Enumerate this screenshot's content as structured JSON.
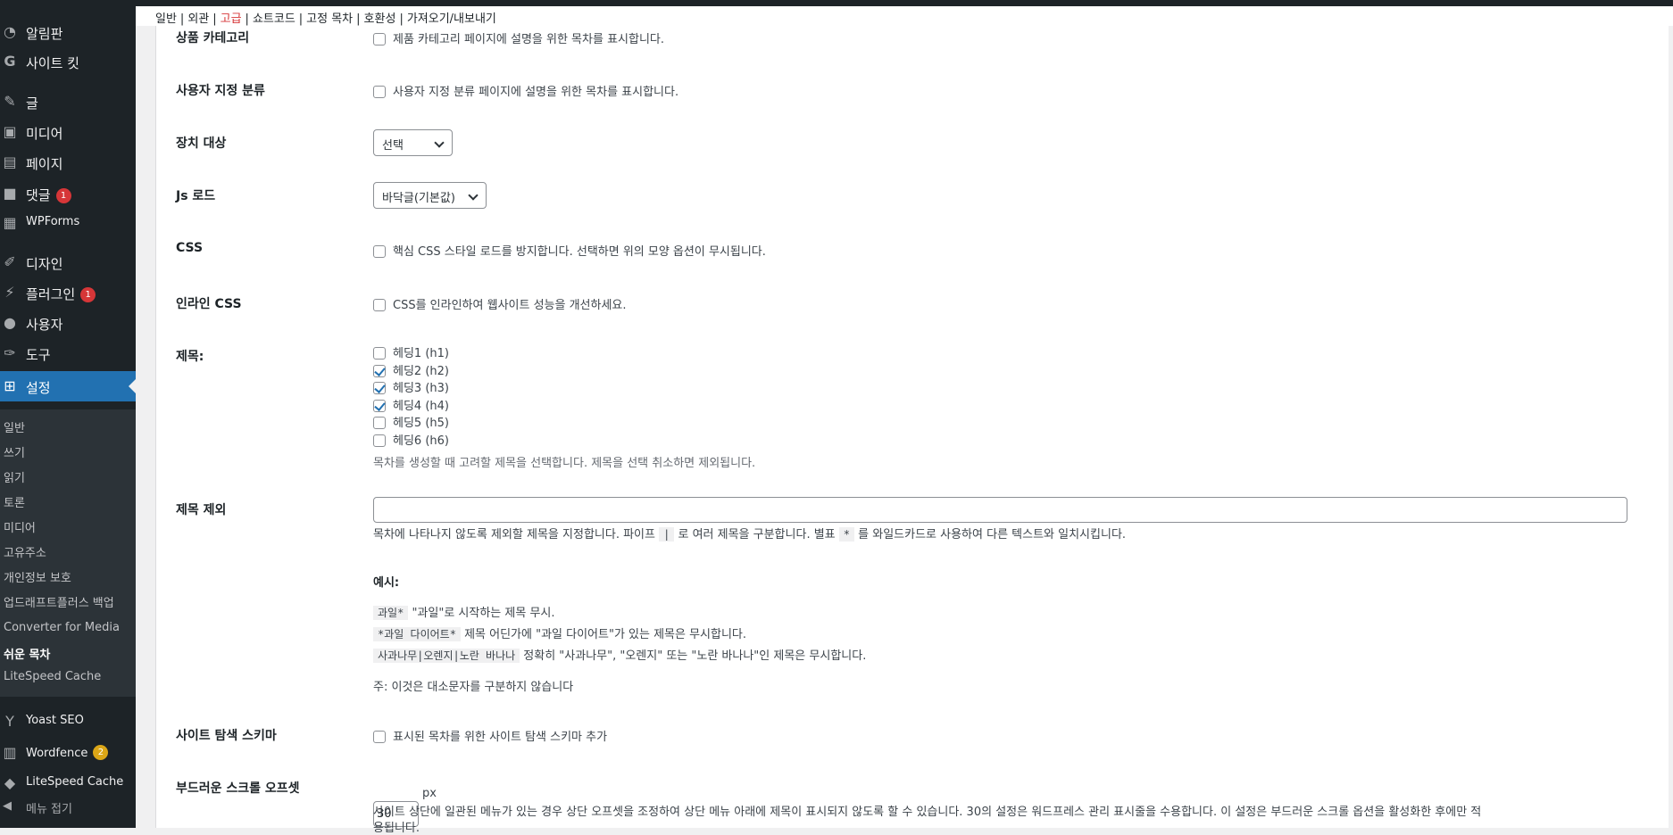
{
  "sidebar": {
    "items": [
      {
        "label": "알림판",
        "icon": "dashboard-icon"
      },
      {
        "label": "사이트 킷",
        "icon": "google-g-icon"
      },
      {
        "label": "글",
        "icon": "pin-icon"
      },
      {
        "label": "미디어",
        "icon": "media-icon"
      },
      {
        "label": "페이지",
        "icon": "page-icon"
      },
      {
        "label": "댓글",
        "icon": "comment-icon",
        "badge": "1"
      },
      {
        "label": "WPForms",
        "icon": "forms-icon"
      },
      {
        "label": "디자인",
        "icon": "paintbrush-icon"
      },
      {
        "label": "플러그인",
        "icon": "plugin-icon",
        "badge": "1"
      },
      {
        "label": "사용자",
        "icon": "user-icon"
      },
      {
        "label": "도구",
        "icon": "wrench-icon"
      },
      {
        "label": "설정",
        "icon": "settings-icon"
      },
      {
        "label": "Yoast SEO",
        "icon": "yoast-icon"
      },
      {
        "label": "Wordfence",
        "icon": "wordfence-icon",
        "badge": "2"
      },
      {
        "label": "LiteSpeed Cache",
        "icon": "litespeed-icon"
      }
    ],
    "submenu": [
      "일반",
      "쓰기",
      "읽기",
      "토론",
      "미디어",
      "고유주소",
      "개인정보 보호",
      "업드래프트플러스 백업",
      "Converter for Media",
      "쉬운 목차",
      "LiteSpeed Cache"
    ],
    "collapse_label": "메뉴 접기"
  },
  "tabs": [
    "일반",
    "외관",
    "고급",
    "쇼트코드",
    "고정 목차",
    "호환성",
    "가져오기/내보내기"
  ],
  "tab_sep": "|",
  "rows": {
    "product_category": {
      "label": "상품 카테고리",
      "text": "제품 카테고리 페이지에 설명을 위한 목차를 표시합니다."
    },
    "custom_taxonomy": {
      "label": "사용자 지정 분류",
      "text": "사용자 지정 분류 페이지에 설명을 위한 목차를 표시합니다."
    },
    "device_target": {
      "label": "장치 대상",
      "value": "선택"
    },
    "js_load": {
      "label": "Js 로드",
      "value": "바닥글(기본값)"
    },
    "css": {
      "label": "CSS",
      "text": "핵심 CSS 스타일 로드를 방지합니다. 선택하면 위의 모양 옵션이 무시됩니다."
    },
    "inline_css": {
      "label": "인라인 CSS",
      "text": "CSS를 인라인하여 웹사이트 성능을 개선하세요."
    },
    "headings": {
      "label": "제목:",
      "items": [
        {
          "text": "헤딩1 (h1)",
          "checked": false
        },
        {
          "text": "헤딩2 (h2)",
          "checked": true
        },
        {
          "text": "헤딩3 (h3)",
          "checked": true
        },
        {
          "text": "헤딩4 (h4)",
          "checked": true
        },
        {
          "text": "헤딩5 (h5)",
          "checked": false
        },
        {
          "text": "헤딩6 (h6)",
          "checked": false
        }
      ],
      "desc": "목차를 생성할 때 고려할 제목을 선택합니다. 제목을 선택 취소하면 제외됩니다."
    },
    "exclude_headings": {
      "label": "제목 제외",
      "value": "",
      "desc_a": "목차에 나타나지 않도록 제외할 제목을 지정합니다. 파이프",
      "code_pipe": "|",
      "desc_b": "로 여러 제목을 구분합니다. 별표",
      "code_star": "*",
      "desc_c": "를 와일드카드로 사용하여 다른 텍스트와 일치시킵니다.",
      "examples_title": "예시:",
      "examples": [
        {
          "code": "과일*",
          "text": "\"과일\"로 시작하는 제목 무시."
        },
        {
          "code": "*과일 다이어트*",
          "text": "제목 어딘가에 \"과일 다이어트\"가 있는 제목은 무시합니다."
        },
        {
          "code": "사과나무|오렌지|노란 바나나",
          "text": "정확히 \"사과나무\", \"오렌지\" 또는 \"노란 바나나\"인 제목은 무시합니다."
        }
      ],
      "note": "주: 이것은 대소문자를 구분하지 않습니다"
    },
    "sitemap_schema": {
      "label": "사이트 탐색 스키마",
      "text": "표시된 목차를 위한 사이트 탐색 스키마 추가"
    },
    "smooth_scroll_offset": {
      "label": "부드러운 스크롤 오프셋",
      "value": "30",
      "unit": "px",
      "desc": "사이트 상단에 일관된 메뉴가 있는 경우 상단 오프셋을 조정하여 상단 메뉴 아래에 제목이 표시되지 않도록 할 수 있습니다. 30의 설정은 워드프레스 관리 표시줄을 수용합니다. 이 설정은 부드러운 스크롤 옵션을 활성화한 후에만 적",
      "desc_cont": "용됩니다."
    }
  }
}
